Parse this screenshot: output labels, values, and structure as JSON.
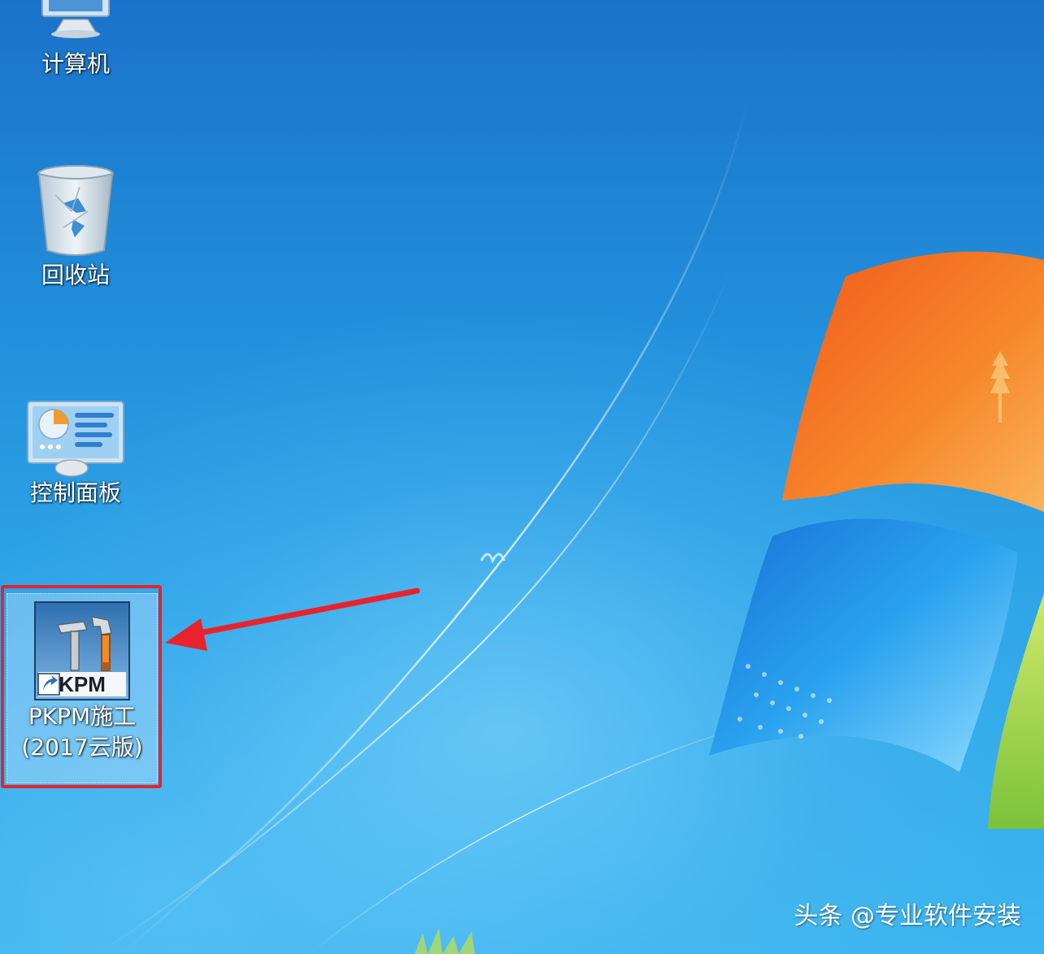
{
  "desktop": {
    "icons": [
      {
        "label": "计算机",
        "icon": "computer-icon"
      },
      {
        "label": "回收站",
        "icon": "recycle-bin-icon"
      },
      {
        "label": "控制面板",
        "icon": "control-panel-icon"
      },
      {
        "label_line1": "PKPM施工",
        "label_line2": "(2017云版)",
        "icon": "pkpm-app-icon",
        "selected": true
      }
    ]
  },
  "annotation": {
    "highlight_color": "#e8232b"
  },
  "watermark": {
    "text": "头条 @专业软件安装"
  },
  "colors": {
    "wallpaper_blue": "#2290dc",
    "logo_orange": "#f07a2a",
    "logo_blue": "#1e8ee0"
  }
}
